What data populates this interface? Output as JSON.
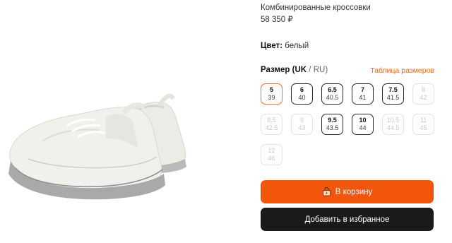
{
  "product": {
    "name": "Комбинированные кроссовки",
    "price": "58 350 ₽"
  },
  "color": {
    "label": "Цвет",
    "value": "белый"
  },
  "size": {
    "label": "Размер",
    "system_active": "UK",
    "system_other": "RU",
    "table_link": "Таблица размеров",
    "options": [
      {
        "uk": "5",
        "ru": "39",
        "state": "selected"
      },
      {
        "uk": "6",
        "ru": "40",
        "state": "available"
      },
      {
        "uk": "6.5",
        "ru": "40.5",
        "state": "available"
      },
      {
        "uk": "7",
        "ru": "41",
        "state": "available"
      },
      {
        "uk": "7.5",
        "ru": "41.5",
        "state": "available"
      },
      {
        "uk": "8",
        "ru": "42",
        "state": "unavailable"
      },
      {
        "uk": "8.5",
        "ru": "42.5",
        "state": "unavailable"
      },
      {
        "uk": "9",
        "ru": "43",
        "state": "unavailable"
      },
      {
        "uk": "9.5",
        "ru": "43.5",
        "state": "available"
      },
      {
        "uk": "10",
        "ru": "44",
        "state": "available"
      },
      {
        "uk": "10.5",
        "ru": "44.5",
        "state": "unavailable"
      },
      {
        "uk": "11",
        "ru": "45",
        "state": "unavailable"
      },
      {
        "uk": "12",
        "ru": "46",
        "state": "unavailable"
      }
    ]
  },
  "buttons": {
    "cart_label": "В корзину",
    "cart_icon": "lock-bag-icon",
    "favorites_label": "Добавить в избранное"
  },
  "colors": {
    "accent": "#f2560a",
    "selected_border": "#f26c2b",
    "dark_button": "#1a1a1a"
  }
}
